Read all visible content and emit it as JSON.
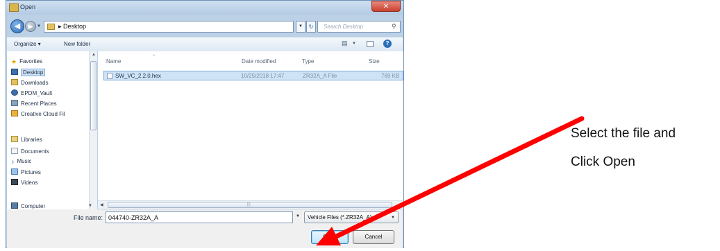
{
  "window": {
    "title": "Open",
    "close_glyph": "✕"
  },
  "address": {
    "path": "▸ Desktop",
    "search_placeholder": "Search Desktop"
  },
  "toolbar": {
    "organize": "Organize ▾",
    "new_folder": "New folder"
  },
  "sidebar": {
    "items": [
      {
        "label": "Favorites",
        "icon": "star-icon"
      },
      {
        "label": "Desktop",
        "icon": "desktop-icon",
        "selected": true
      },
      {
        "label": "Downloads",
        "icon": "downloads-icon"
      },
      {
        "label": "EPDM_Vault",
        "icon": "vault-icon"
      },
      {
        "label": "Recent Places",
        "icon": "recent-places-icon"
      },
      {
        "label": "Creative Cloud Fil",
        "icon": "creative-cloud-icon"
      },
      {
        "label": "Libraries",
        "icon": "libraries-icon"
      },
      {
        "label": "Documents",
        "icon": "documents-icon"
      },
      {
        "label": "Music",
        "icon": "music-icon"
      },
      {
        "label": "Pictures",
        "icon": "pictures-icon"
      },
      {
        "label": "Videos",
        "icon": "videos-icon"
      },
      {
        "label": "Computer",
        "icon": "computer-icon"
      }
    ]
  },
  "filelist": {
    "columns": [
      "Name",
      "Date modified",
      "Type",
      "Size"
    ],
    "rows": [
      {
        "name": "SW_VC_2.2.0.hex",
        "date": "10/25/2018 17:47",
        "type": "ZR32A_A File",
        "size": "769 KB"
      }
    ]
  },
  "bottom": {
    "filename_label": "File name:",
    "filename_value": "044740-ZR32A_A",
    "filter_value": "Vehicle Files (*.ZR32A_A)",
    "open_label": "Open",
    "cancel_label": "Cancel"
  },
  "annotation": {
    "line1": "Select the file and",
    "line2": "Click Open",
    "arrow_color": "#ff0000"
  },
  "colors": {
    "selection": "#cfe3f7",
    "selection_border": "#7fa9d8",
    "window_frame": "#bcd0e6"
  }
}
